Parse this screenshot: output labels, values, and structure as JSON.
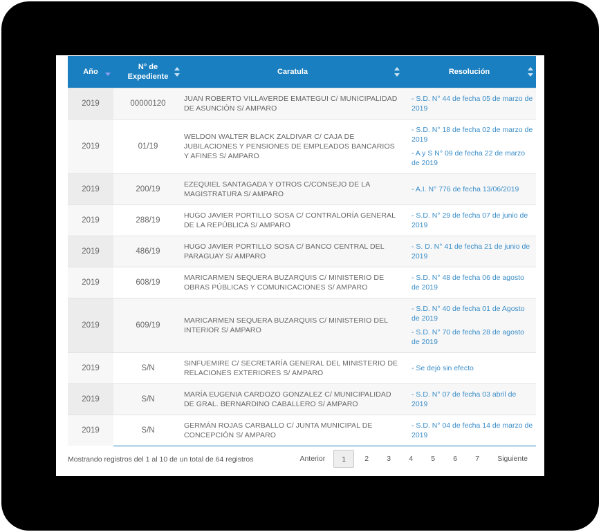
{
  "table": {
    "headers": [
      {
        "label": "Año",
        "sort": "desc"
      },
      {
        "label": "N° de Expediente",
        "sort": "both"
      },
      {
        "label": "Caratula",
        "sort": "both"
      },
      {
        "label": "Resolución",
        "sort": "both"
      }
    ],
    "rows": [
      {
        "anio": "2019",
        "expediente": "00000120",
        "caratula": "JUAN ROBERTO VILLAVERDE EMATEGUI C/ MUNICIPALIDAD DE ASUNCIÓN S/ AMPARO",
        "resoluciones": [
          "- S.D. N° 44 de fecha 05 de marzo de 2019"
        ]
      },
      {
        "anio": "2019",
        "expediente": "01/19",
        "caratula": "WELDON WALTER BLACK ZALDIVAR C/ CAJA DE JUBILACIONES Y PENSIONES DE EMPLEADOS BANCARIOS Y AFINES S/ AMPARO",
        "resoluciones": [
          "- S.D. N° 18 de fecha 02 de marzo de 2019",
          "- A y S N° 09 de fecha 22 de marzo de 2019"
        ]
      },
      {
        "anio": "2019",
        "expediente": "200/19",
        "caratula": "EZEQUIEL SANTAGADA Y OTROS C/CONSEJO DE LA MAGISTRATURA S/ AMPARO",
        "resoluciones": [
          "- A.I. N° 776 de fecha 13/06/2019"
        ]
      },
      {
        "anio": "2019",
        "expediente": "288/19",
        "caratula": "HUGO JAVIER PORTILLO SOSA C/ CONTRALORÍA GENERAL DE LA REPÚBLICA S/ AMPARO",
        "resoluciones": [
          "- S.D. N° 29 de fecha 07 de junio de 2019"
        ]
      },
      {
        "anio": "2019",
        "expediente": "486/19",
        "caratula": "HUGO JAVIER PORTILLO SOSA C/ BANCO CENTRAL DEL PARAGUAY S/ AMPARO",
        "resoluciones": [
          "- S. D. N° 41 de fecha 21 de junio de 2019"
        ]
      },
      {
        "anio": "2019",
        "expediente": "608/19",
        "caratula": "MARICARMEN SEQUERA BUZARQUIS C/ MINISTERIO DE OBRAS PÚBLICAS Y COMUNICACIONES S/ AMPARO",
        "resoluciones": [
          "- S.D. N° 48 de fecha 06 de agosto de 2019"
        ]
      },
      {
        "anio": "2019",
        "expediente": "609/19",
        "caratula": "MARICARMEN SEQUERA BUZARQUIS C/ MINISTERIO DEL INTERIOR S/ AMPARO",
        "resoluciones": [
          "- S.D. N° 40 de fecha 01 de Agosto de 2019",
          "- S.D. N° 70 de fecha 28 de agosto de 2019"
        ]
      },
      {
        "anio": "2019",
        "expediente": "S/N",
        "caratula": "SINFUEMIRE C/ SECRETARÍA GENERAL DEL MINISTERIO DE RELACIONES EXTERIORES S/ AMPARO",
        "resoluciones": [
          "- Se dejó sin efecto"
        ]
      },
      {
        "anio": "2019",
        "expediente": "S/N",
        "caratula": "MARÍA EUGENIA CARDOZO GONZALEZ C/ MUNICIPALIDAD DE GRAL. BERNARDINO CABALLERO S/ AMPARO",
        "resoluciones": [
          "- S.D. N° 07 de fecha 03 abril de 2019"
        ]
      },
      {
        "anio": "2019",
        "expediente": "S/N",
        "caratula": "GERMÁN ROJAS CARBALLO C/ JUNTA MUNICIPAL DE CONCEPCIÓN S/ AMPARO",
        "resoluciones": [
          "- S.D. N° 04 de fecha 14 de marzo de 2019"
        ]
      }
    ]
  },
  "info": "Mostrando registros del 1 al 10 de un total de 64 registros",
  "pagination": {
    "previous": "Anterior",
    "next": "Siguiente",
    "pages": [
      "1",
      "2",
      "3",
      "4",
      "5",
      "6",
      "7"
    ],
    "current": "1"
  },
  "colors": {
    "header_bg": "#1a7fc0",
    "link": "#3a8dc8",
    "frame": "#000000"
  }
}
